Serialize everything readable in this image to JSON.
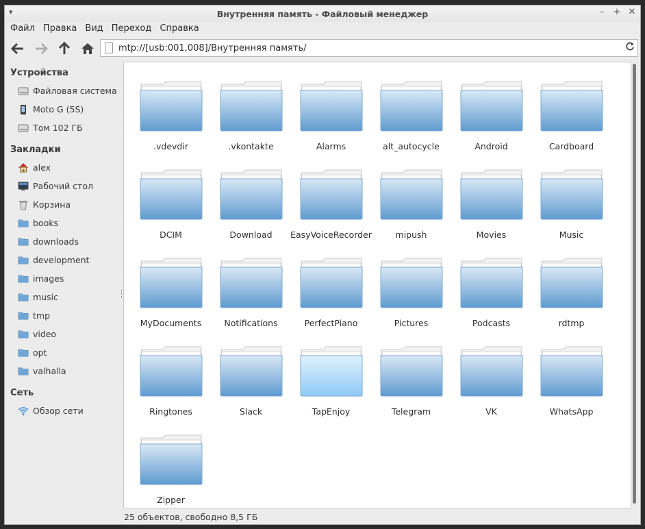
{
  "window": {
    "title": "Внутренняя память - Файловый менеджер"
  },
  "menu": [
    "Файл",
    "Правка",
    "Вид",
    "Переход",
    "Справка"
  ],
  "toolbar": {
    "address": "mtp://[usb:001,008]/Внутренняя память/",
    "buttons": [
      "back-arrow-icon",
      "forward-arrow-icon",
      "up-arrow-icon",
      "home-icon"
    ]
  },
  "sidebar": {
    "devices": {
      "title": "Устройства",
      "items": [
        {
          "label": "Файловая система",
          "icon": "drive-icon"
        },
        {
          "label": "Moto G (5S)",
          "icon": "phone-icon"
        },
        {
          "label": "Том 102 ГБ",
          "icon": "drive-icon"
        }
      ]
    },
    "bookmarks": {
      "title": "Закладки",
      "items": [
        {
          "label": "alex",
          "icon": "home-icon"
        },
        {
          "label": "Рабочий стол",
          "icon": "desktop-icon"
        },
        {
          "label": "Корзина",
          "icon": "trash-icon"
        },
        {
          "label": "books",
          "icon": "folder-icon"
        },
        {
          "label": "downloads",
          "icon": "folder-icon"
        },
        {
          "label": "development",
          "icon": "folder-icon"
        },
        {
          "label": "images",
          "icon": "folder-icon"
        },
        {
          "label": "music",
          "icon": "folder-icon"
        },
        {
          "label": "tmp",
          "icon": "folder-icon"
        },
        {
          "label": "video",
          "icon": "folder-icon"
        },
        {
          "label": "opt",
          "icon": "folder-icon"
        },
        {
          "label": "valhalla",
          "icon": "folder-icon"
        }
      ]
    },
    "network": {
      "title": "Сеть",
      "items": [
        {
          "label": "Обзор сети",
          "icon": "wifi-icon"
        }
      ]
    }
  },
  "folders": [
    ".vdevdir",
    ".vkontakte",
    "Alarms",
    "alt_autocycle",
    "Android",
    "Cardboard",
    "DCIM",
    "Download",
    "EasyVoiceRecorder",
    "mipush",
    "Movies",
    "Music",
    "MyDocuments",
    "Notifications",
    "PerfectPiano",
    "Pictures",
    "Podcasts",
    "rdtmp",
    "Ringtones",
    "Slack",
    "TapEnjoy",
    "Telegram",
    "VK",
    "WhatsApp",
    "Zipper"
  ],
  "selected_folder": "TapEnjoy",
  "status": "25 объектов, свободно 8,5 ГБ",
  "colors": {
    "folder": "#6fa6d6",
    "folder_selected": "#9fd0f5",
    "accent": "#4a90d9"
  }
}
